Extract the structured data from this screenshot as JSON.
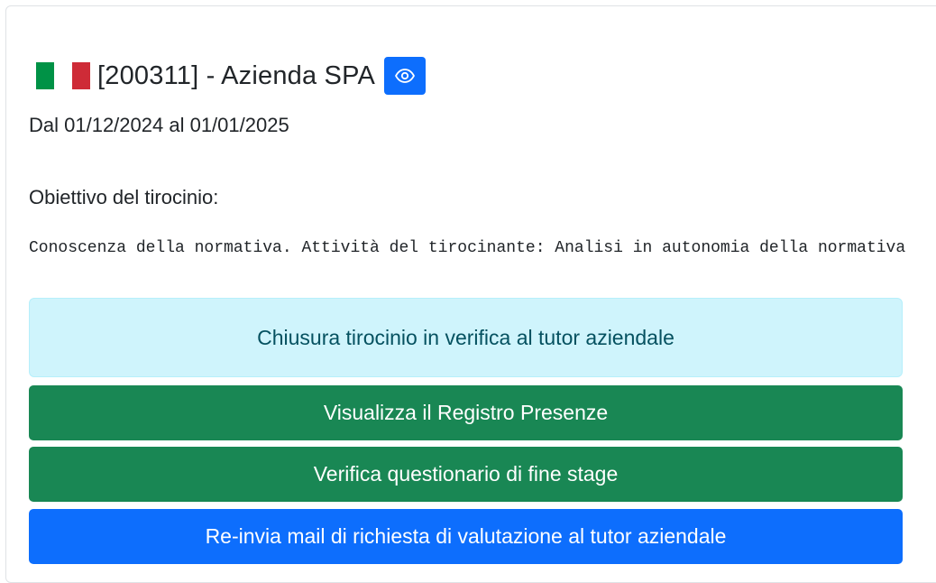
{
  "header": {
    "flag_colors": {
      "green": "#009246",
      "white": "#ffffff",
      "red": "#ce2b37"
    },
    "title": "[200311] - Azienda SPA",
    "view_icon": "eye-icon",
    "view_button_color": "#0d6efd"
  },
  "period": {
    "text": "Dal 01/12/2024 al 01/01/2025"
  },
  "objective": {
    "label": "Obiettivo del tirocinio:",
    "text": "Conoscenza della normativa. Attività del tirocinante: Analisi in autonomia della normativa"
  },
  "status": {
    "text": "Chiusura tirocinio in verifica al tutor aziendale",
    "bg_color": "#cff4fc",
    "text_color": "#055160"
  },
  "actions": {
    "registro_label": "Visualizza il Registro Presenze",
    "questionario_label": "Verifica questionario di fine stage",
    "reinvia_label": "Re-invia mail di richiesta di valutazione al tutor aziendale",
    "success_color": "#198754",
    "primary_color": "#0d6efd"
  }
}
